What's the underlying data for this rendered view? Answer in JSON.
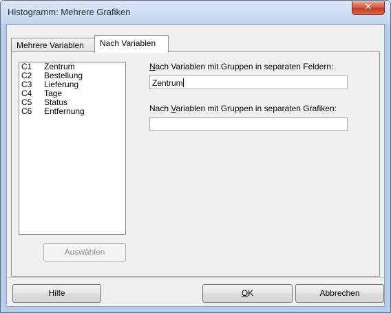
{
  "window": {
    "title": "Histogramm: Mehrere Grafiken",
    "close_glyph": "✕"
  },
  "tabs": [
    {
      "label": "Mehrere Variablen",
      "active": false
    },
    {
      "label": "Nach Variablen",
      "active": true
    }
  ],
  "variables": [
    {
      "col": "C1",
      "name": "Zentrum"
    },
    {
      "col": "C2",
      "name": "Bestellung"
    },
    {
      "col": "C3",
      "name": "Lieferung"
    },
    {
      "col": "C4",
      "name": "Tage"
    },
    {
      "col": "C5",
      "name": "Status"
    },
    {
      "col": "C6",
      "name": "Entfernung"
    }
  ],
  "fields": {
    "separate_panels": {
      "label_prefix": "",
      "label_mnemonic": "N",
      "label_rest": "ach Variablen mit Gruppen in separaten Feldern:",
      "value": "Zentrum"
    },
    "separate_graphs": {
      "label_prefix": "Nach ",
      "label_mnemonic": "V",
      "label_rest": "ariablen mit Gruppen in separaten Grafiken:",
      "value": ""
    }
  },
  "buttons": {
    "select": "Auswählen",
    "help": "Hilfe",
    "ok_mnemonic": "O",
    "ok_rest": "K",
    "cancel": "Abbrechen"
  }
}
